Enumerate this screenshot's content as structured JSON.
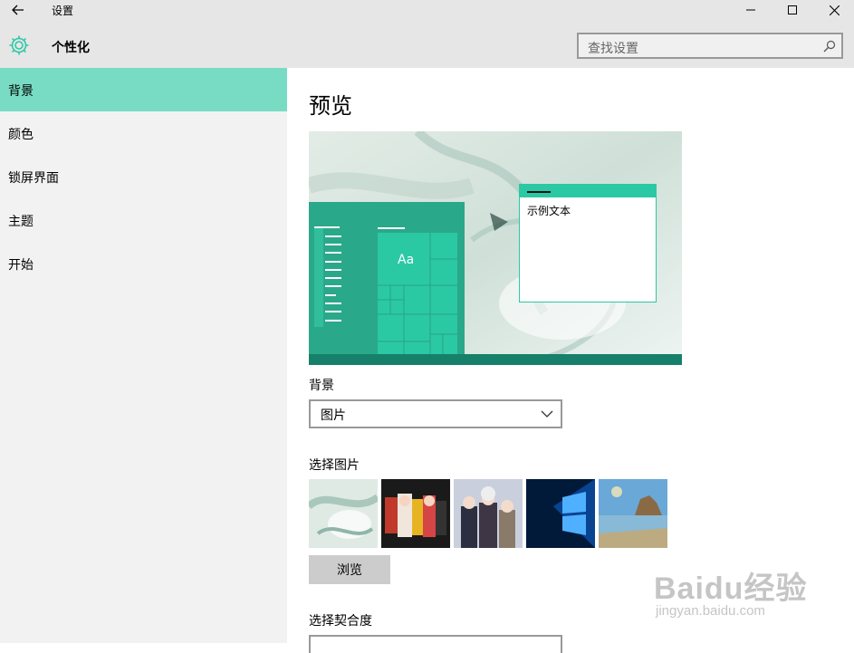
{
  "window": {
    "title": "设置"
  },
  "header": {
    "section_title": "个性化",
    "search_placeholder": "查找设置"
  },
  "sidebar": {
    "items": [
      {
        "label": "背景",
        "active": true
      },
      {
        "label": "颜色",
        "active": false
      },
      {
        "label": "锁屏界面",
        "active": false
      },
      {
        "label": "主题",
        "active": false
      },
      {
        "label": "开始",
        "active": false
      }
    ]
  },
  "main": {
    "preview_heading": "预览",
    "preview": {
      "tile_text": "Aa",
      "sample_window_text": "示例文本"
    },
    "background_label": "背景",
    "background_value": "图片",
    "choose_picture_label": "选择图片",
    "browse_label": "浏览",
    "fit_label": "选择契合度"
  },
  "watermark": {
    "brand": "Baidu经验",
    "url": "jingyan.baidu.com"
  },
  "colors": {
    "accent": "#2bc8a4",
    "nav_active": "#77dcc3",
    "taskbar": "#16806a",
    "start_menu": "#2aa88a"
  }
}
